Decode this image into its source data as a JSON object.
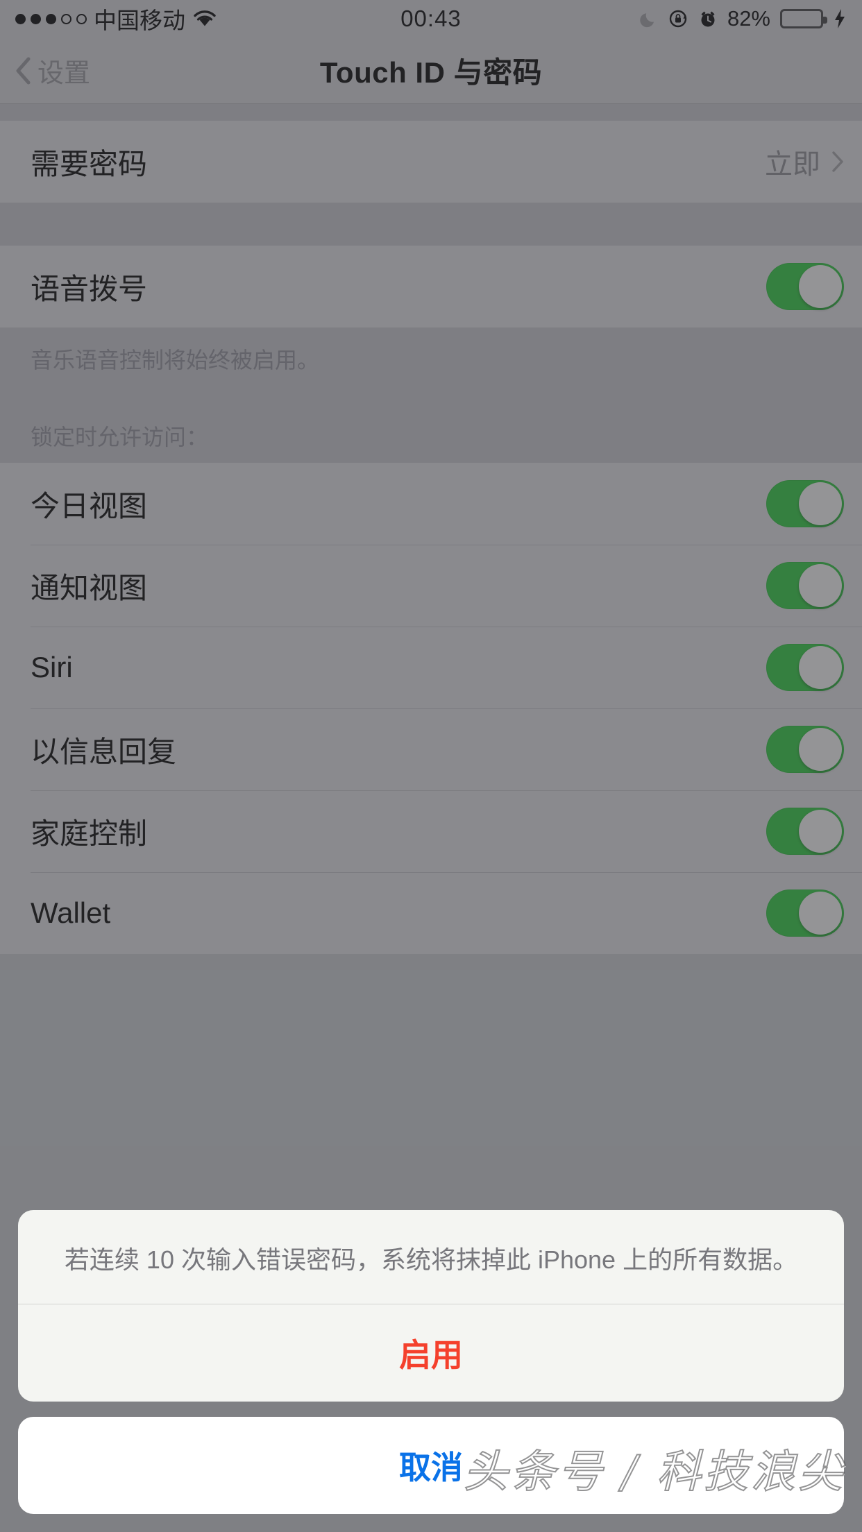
{
  "status_bar": {
    "signal_dots_filled": 3,
    "signal_dots_total": 5,
    "carrier": "中国移动",
    "wifi_icon": "wifi-icon",
    "time": "00:43",
    "do_not_disturb_icon": "moon-icon",
    "rotation_lock_icon": "rotation-lock-icon",
    "alarm_icon": "alarm-clock-icon",
    "battery_percent": "82%",
    "battery_level": 82,
    "charging_icon": "lightning-bolt-icon"
  },
  "nav_bar": {
    "back_icon": "chevron-left-icon",
    "back_label": "设置",
    "title": "Touch ID 与密码"
  },
  "sections": {
    "require_passcode": {
      "label": "需要密码",
      "value": "立即",
      "disclosure_icon": "chevron-right-icon"
    },
    "voice_dial": {
      "label": "语音拨号",
      "toggle_on": true,
      "footnote": "音乐语音控制将始终被启用。"
    },
    "allow_access_when_locked": {
      "header": "锁定时允许访问：",
      "items": [
        {
          "label": "今日视图",
          "toggle_on": true
        },
        {
          "label": "通知视图",
          "toggle_on": true
        },
        {
          "label": "Siri",
          "toggle_on": true
        },
        {
          "label": "以信息回复",
          "toggle_on": true
        },
        {
          "label": "家庭控制",
          "toggle_on": true
        },
        {
          "label": "Wallet",
          "toggle_on": true
        }
      ]
    }
  },
  "alert": {
    "message": "若连续 10 次输入错误密码，系统将抹掉此 iPhone 上的所有数据。",
    "confirm_label": "启用",
    "cancel_label": "取消",
    "confirm_color": "#f4402c",
    "cancel_color": "#0a72e8"
  },
  "watermark": {
    "text": "头条号 / 科技浪尖"
  },
  "colors": {
    "toggle_on": "#2f9a3d",
    "battery_green": "#4cd964",
    "destructive_red": "#f4402c",
    "link_blue": "#0a72e8"
  }
}
